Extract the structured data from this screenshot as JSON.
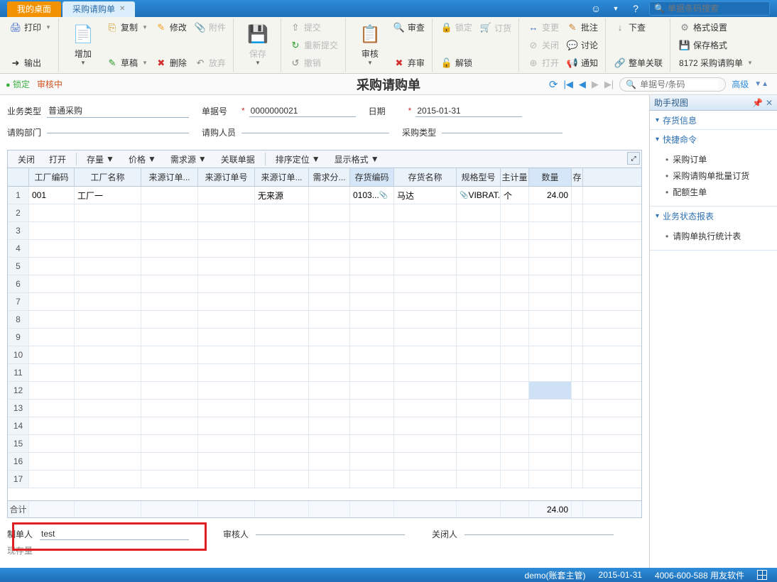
{
  "tabs": {
    "desktop": "我的桌面",
    "current": "采购请购单"
  },
  "topsearch_placeholder": "单据条码搜索",
  "ribbon": {
    "print": "打印",
    "export": "输出",
    "add": "增加",
    "copy": "复制",
    "edit": "修改",
    "attach": "附件",
    "draft": "草稿",
    "delete": "删除",
    "discard": "放弃",
    "save": "保存",
    "submit": "提交",
    "resubmit": "重新提交",
    "revoke": "撤销",
    "audit": "审核",
    "review": "审查",
    "reject": "弃审",
    "lock": "锁定",
    "order": "订货",
    "unlock": "解锁",
    "change": "变更",
    "close": "关闭",
    "open": "打开",
    "note": "批注",
    "discuss": "讨论",
    "notify": "通知",
    "checkdown": "下查",
    "whole": "整单关联",
    "format": "格式设置",
    "savefmt": "保存格式",
    "doc": "8172 采购请购单"
  },
  "status": {
    "lock": "锁定",
    "auditing": "审核中",
    "title": "采购请购单",
    "search_ph": "单据号/条码",
    "adv": "高级"
  },
  "form": {
    "biztype_l": "业务类型",
    "biztype_v": "普通采购",
    "docno_l": "单据号",
    "docno_v": "0000000021",
    "date_l": "日期",
    "date_v": "2015-01-31",
    "dept_l": "请购部门",
    "dept_v": "",
    "person_l": "请购人员",
    "person_v": "",
    "ptype_l": "采购类型",
    "ptype_v": ""
  },
  "tbltool": {
    "close": "关闭",
    "open": "打开",
    "stock": "存量",
    "price": "价格",
    "demand": "需求源",
    "link": "关联单据",
    "sort": "排序定位",
    "display": "显示格式"
  },
  "cols": {
    "fcode": "工厂编码",
    "fname": "工厂名称",
    "srcord": "来源订单...",
    "srcno": "来源订单号",
    "srcord2": "来源订单...",
    "demand": "需求分...",
    "invcode": "存货编码",
    "invname": "存货名称",
    "spec": "规格型号",
    "unit": "主计量",
    "qty": "数量",
    "more": "存"
  },
  "row1": {
    "fcode": "001",
    "fname": "工厂一",
    "src": "无来源",
    "invcode": "0103...",
    "invname": "马达",
    "spec": "VIBRAT...",
    "unit": "个",
    "qty": "24.00"
  },
  "footrow": {
    "label": "合计",
    "qty": "24.00"
  },
  "bottom": {
    "maker_l": "制单人",
    "maker_v": "test",
    "auditor_l": "审核人",
    "closer_l": "关闭人",
    "stock_l": "现存量"
  },
  "side": {
    "title": "助手视图",
    "s1": "存货信息",
    "s2": "快捷命令",
    "s2_items": [
      "采购订单",
      "采购请购单批量订货",
      "配额生单"
    ],
    "s3": "业务状态报表",
    "s3_items": [
      "请购单执行统计表"
    ]
  },
  "footer": {
    "user": "demo(账套主管)",
    "date": "2015-01-31",
    "phone": "4006-600-588 用友软件"
  }
}
